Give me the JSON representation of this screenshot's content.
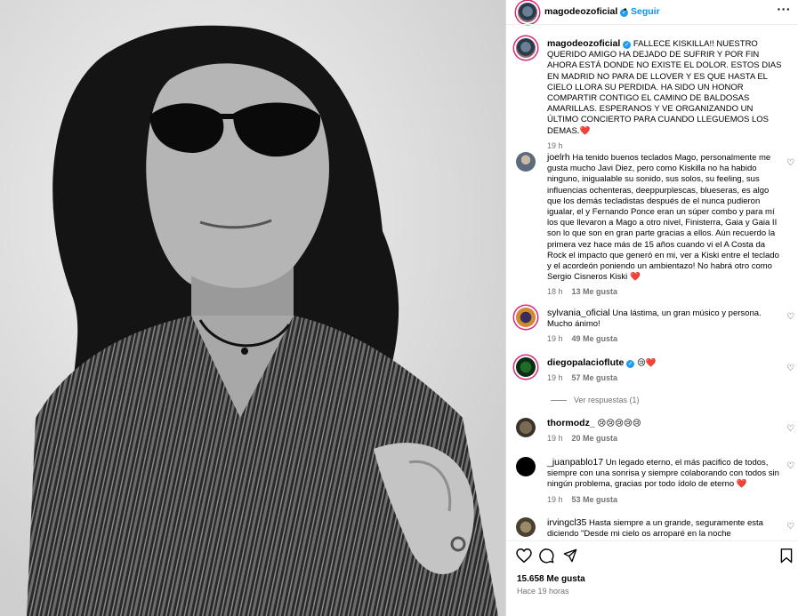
{
  "post": {
    "author": "magodeozoficial",
    "follow_label": "Seguir",
    "caption": "FALLECE KISKILLA!! NUESTRO QUERIDO AMIGO HA DEJADO DE SUFRIR Y POR FIN AHORA ESTÁ DONDE NO EXISTE EL DOLOR. ESTOS DIAS EN MADRID NO PARA DE LLOVER Y ES QUE HASTA EL CIELO LLORA SU PERDIDA. HA SIDO UN HONOR COMPARTIR CONTIGO EL CAMINO DE BALDOSAS AMARILLAS. ESPERANOS Y VE ORGANIZANDO UN ÚLTIMO CONCIERTO PARA CUANDO LLEGUEMOS LOS DEMAS.",
    "caption_time": "19 h",
    "likes": "15.658 Me gusta",
    "posted_ago": "Hace 19 horas"
  },
  "comments": [
    {
      "user": "joelrh",
      "text": "Ha tenido buenos teclados Mago, personalmente me gusta mucho Javi Diez, pero como Kiskilla no ha habido ninguno, inigualable su sonido, sus solos, su feeling, sus influencias ochenteras, deeppurplescas, blueseras, es algo que los demás tecladistas después de el nunca pudieron igualar, el y Fernando Ponce eran un súper combo y para mí los que llevaron a Mago a otro nivel, Finisterra, Gaia y Gaia II son lo que son en gran parte gracias a ellos. Aún recuerdo la primera vez hace más de 15 años cuando vi el A Costa da Rock el impacto que generó en mi, ver a Kiski entre el teclado y el acordeón poniendo un ambientazo! No habrá otro como Sergio Cisneros Kiski",
      "time": "18 h",
      "likes": "13 Me gusta"
    },
    {
      "user": "sylvania_oficial",
      "text": "Una lástima, un gran músico y persona. Mucho ánimo!",
      "time": "19 h",
      "likes": "49 Me gusta"
    },
    {
      "user": "diegopalacioflute",
      "text": "😢",
      "time": "19 h",
      "likes": "57 Me gusta",
      "replies": "Ver respuestas (1)"
    },
    {
      "user": "thormodz_",
      "text": "😢😢😢😢😢",
      "time": "19 h",
      "likes": "20 Me gusta"
    },
    {
      "user": "_juanpablo17",
      "text": "Un legado eterno, el más pacifico de todos, siempre con una sonrisa y siempre colaborando con todos sin ningún problema, gracias por todo ídolo de eterno",
      "time": "19 h",
      "likes": "53 Me gusta"
    },
    {
      "user": "irvingcl35",
      "text": "Hasta siempre a un grande, seguramente esta diciendo \"Desde mi cielo os arroparé en la noche"
    }
  ],
  "icons": [
    "heart-icon",
    "comment-icon",
    "share-icon",
    "bookmark-icon",
    "more-options-icon",
    "verified-icon"
  ],
  "colors": {
    "accent": "#0095f6",
    "heart_red": "#ed4956",
    "muted": "#737373"
  }
}
